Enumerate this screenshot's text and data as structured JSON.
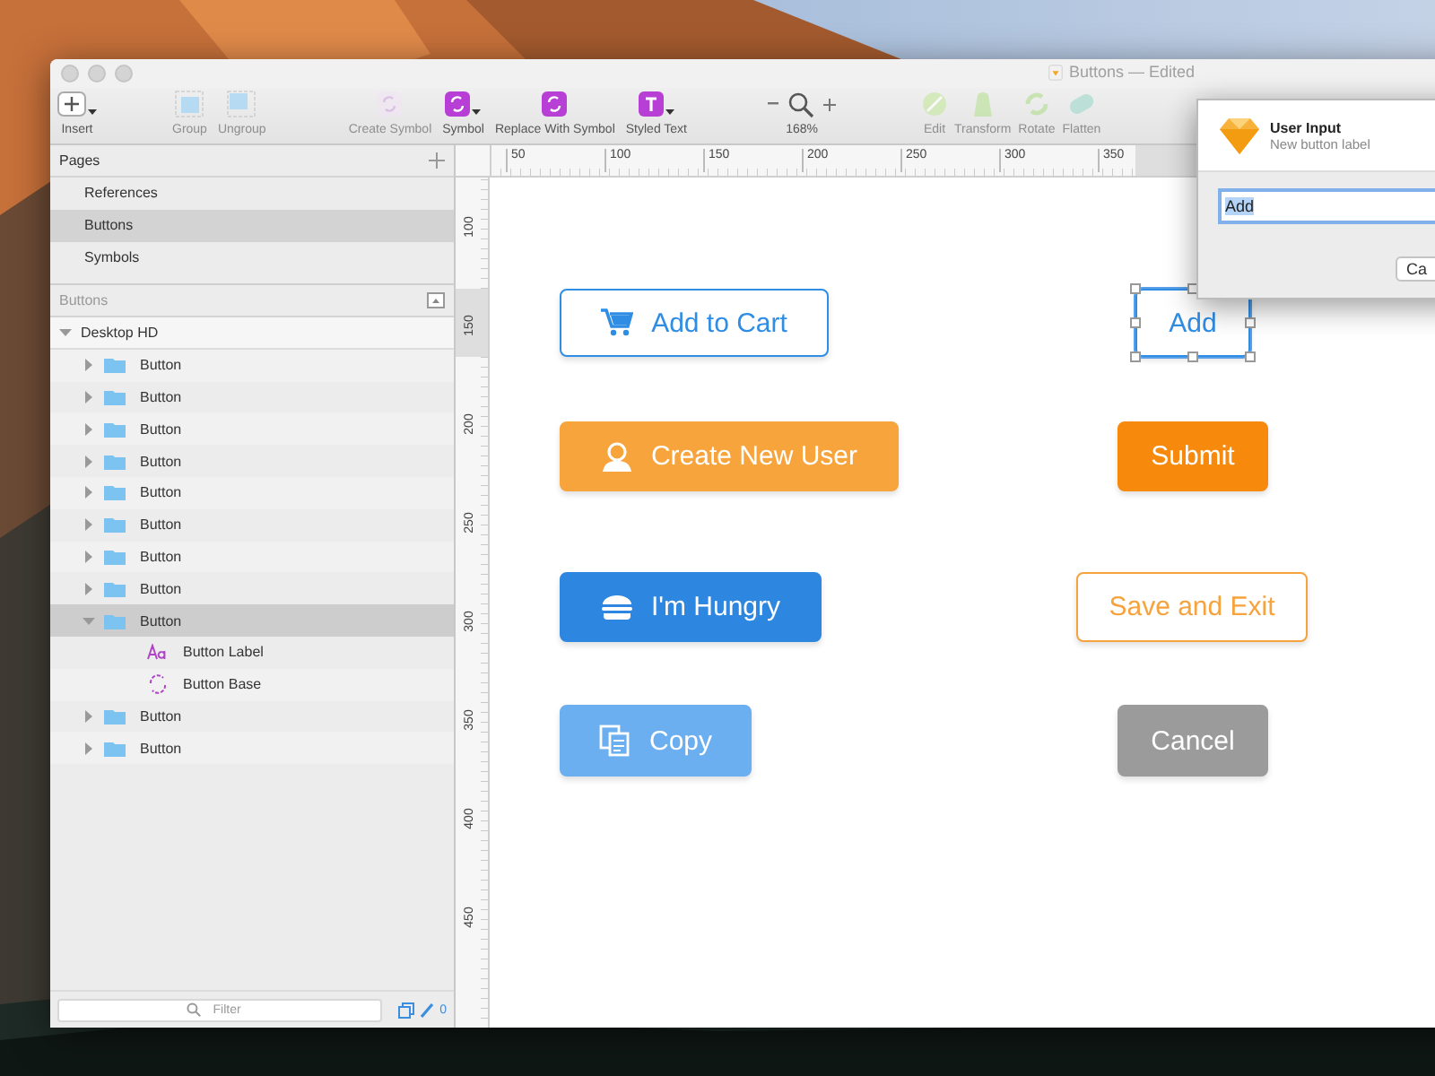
{
  "window": {
    "title": "Buttons — Edited"
  },
  "toolbar": {
    "groups": [
      {
        "items": [
          {
            "kind": "insert",
            "label": "Insert",
            "disabled": false,
            "dropdown": true
          }
        ]
      },
      {
        "items": [
          {
            "kind": "group",
            "label": "Group",
            "disabled": true,
            "dropdown": false
          },
          {
            "kind": "ungroup",
            "label": "Ungroup",
            "disabled": true,
            "dropdown": false
          }
        ]
      },
      {
        "items": [
          {
            "kind": "create-symbol",
            "label": "Create Symbol",
            "disabled": true,
            "dropdown": false
          },
          {
            "kind": "symbol",
            "label": "Symbol",
            "disabled": false,
            "dropdown": true
          },
          {
            "kind": "replace",
            "label": "Replace With Symbol",
            "disabled": false,
            "dropdown": false
          },
          {
            "kind": "styled-text",
            "label": "Styled Text",
            "disabled": false,
            "dropdown": true
          }
        ]
      },
      {
        "items": [
          {
            "kind": "zoom",
            "label": "168%",
            "disabled": false,
            "dropdown": false
          }
        ]
      },
      {
        "items": [
          {
            "kind": "edit",
            "label": "Edit",
            "disabled": true,
            "dropdown": false
          },
          {
            "kind": "transform",
            "label": "Transform",
            "disabled": true,
            "dropdown": false
          },
          {
            "kind": "rotate",
            "label": "Rotate",
            "disabled": true,
            "dropdown": false
          },
          {
            "kind": "flatten",
            "label": "Flatten",
            "disabled": true,
            "dropdown": false
          }
        ]
      }
    ]
  },
  "pages": {
    "title": "Pages",
    "items": [
      {
        "label": "References",
        "selected": false
      },
      {
        "label": "Buttons",
        "selected": true
      },
      {
        "label": "Symbols",
        "selected": false
      }
    ]
  },
  "layers": {
    "title": "Buttons",
    "items": [
      {
        "label": "Desktop HD",
        "kind": "artboard",
        "expanded": true,
        "selected": false,
        "children": [
          {
            "label": "Button",
            "kind": "group",
            "expanded": false,
            "selected": false
          },
          {
            "label": "Button",
            "kind": "group",
            "expanded": false,
            "selected": false
          },
          {
            "label": "Button",
            "kind": "group",
            "expanded": false,
            "selected": false
          },
          {
            "label": "Button",
            "kind": "group",
            "expanded": false,
            "selected": false
          },
          {
            "label": "Button",
            "kind": "group",
            "expanded": false,
            "selected": false
          },
          {
            "label": "Button",
            "kind": "group",
            "expanded": false,
            "selected": false
          },
          {
            "label": "Button",
            "kind": "group",
            "expanded": false,
            "selected": false
          },
          {
            "label": "Button",
            "kind": "group",
            "expanded": false,
            "selected": false
          },
          {
            "label": "Button",
            "kind": "group",
            "expanded": true,
            "selected": true,
            "children": [
              {
                "label": "Button Label",
                "kind": "text",
                "selected": false
              },
              {
                "label": "Button Base",
                "kind": "symbol",
                "selected": false
              }
            ]
          },
          {
            "label": "Button",
            "kind": "group",
            "expanded": false,
            "selected": false
          },
          {
            "label": "Button",
            "kind": "group",
            "expanded": false,
            "selected": false
          }
        ]
      }
    ]
  },
  "filter": {
    "placeholder": "Filter",
    "count": "0"
  },
  "rulers": {
    "horizontal": [
      "50",
      "100",
      "150",
      "200",
      "250",
      "300",
      "350"
    ],
    "vertical": [
      "100",
      "150",
      "200",
      "250",
      "300",
      "350",
      "400",
      "450"
    ]
  },
  "canvas": {
    "buttons": [
      {
        "label": "Add to Cart",
        "kind": "outline",
        "color": "#2f8de4",
        "selected": false
      },
      {
        "label": "Add",
        "kind": "outline",
        "color": "#2f8de4",
        "selected": true
      },
      {
        "label": "Create New User",
        "kind": "filled",
        "color": "#f8a43c",
        "selected": false
      },
      {
        "label": "Submit",
        "kind": "filled",
        "color": "#f78a0c",
        "selected": false
      },
      {
        "label": "I'm Hungry",
        "kind": "filled",
        "color": "#2d86e0",
        "selected": false
      },
      {
        "label": "Save and Exit",
        "kind": "outline",
        "color": "#f6a23d",
        "selected": false
      },
      {
        "label": "Copy",
        "kind": "filled",
        "color": "#6caff0",
        "selected": false
      },
      {
        "label": "Cancel",
        "kind": "filled",
        "color": "#9b9b9b",
        "selected": false
      }
    ]
  },
  "dialog": {
    "title": "User Input",
    "subtitle": "New button label",
    "value": "Add",
    "button": "Ca"
  }
}
